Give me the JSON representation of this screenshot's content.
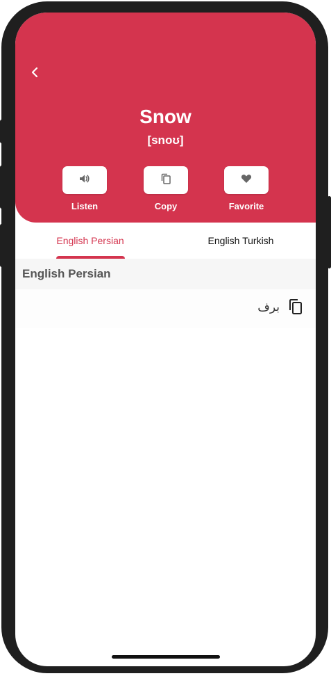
{
  "word": "Snow",
  "phonetic": "[snoʊ]",
  "actions": [
    {
      "label": "Listen",
      "icon": "speaker-icon"
    },
    {
      "label": "Copy",
      "icon": "copy-icon"
    },
    {
      "label": "Favorite",
      "icon": "heart-icon"
    }
  ],
  "tabs": [
    {
      "label": "English Persian",
      "active": true
    },
    {
      "label": "English Turkish",
      "active": false
    }
  ],
  "section": {
    "title": "English Persian",
    "translation": "برف",
    "copy_icon": "copy-icon"
  },
  "colors": {
    "accent": "#d4344e",
    "header_text": "#ffffff",
    "section_bg": "#f6f6f6",
    "frame": "#1f1f1f"
  },
  "icons": {
    "back": "chevron-left-icon"
  }
}
